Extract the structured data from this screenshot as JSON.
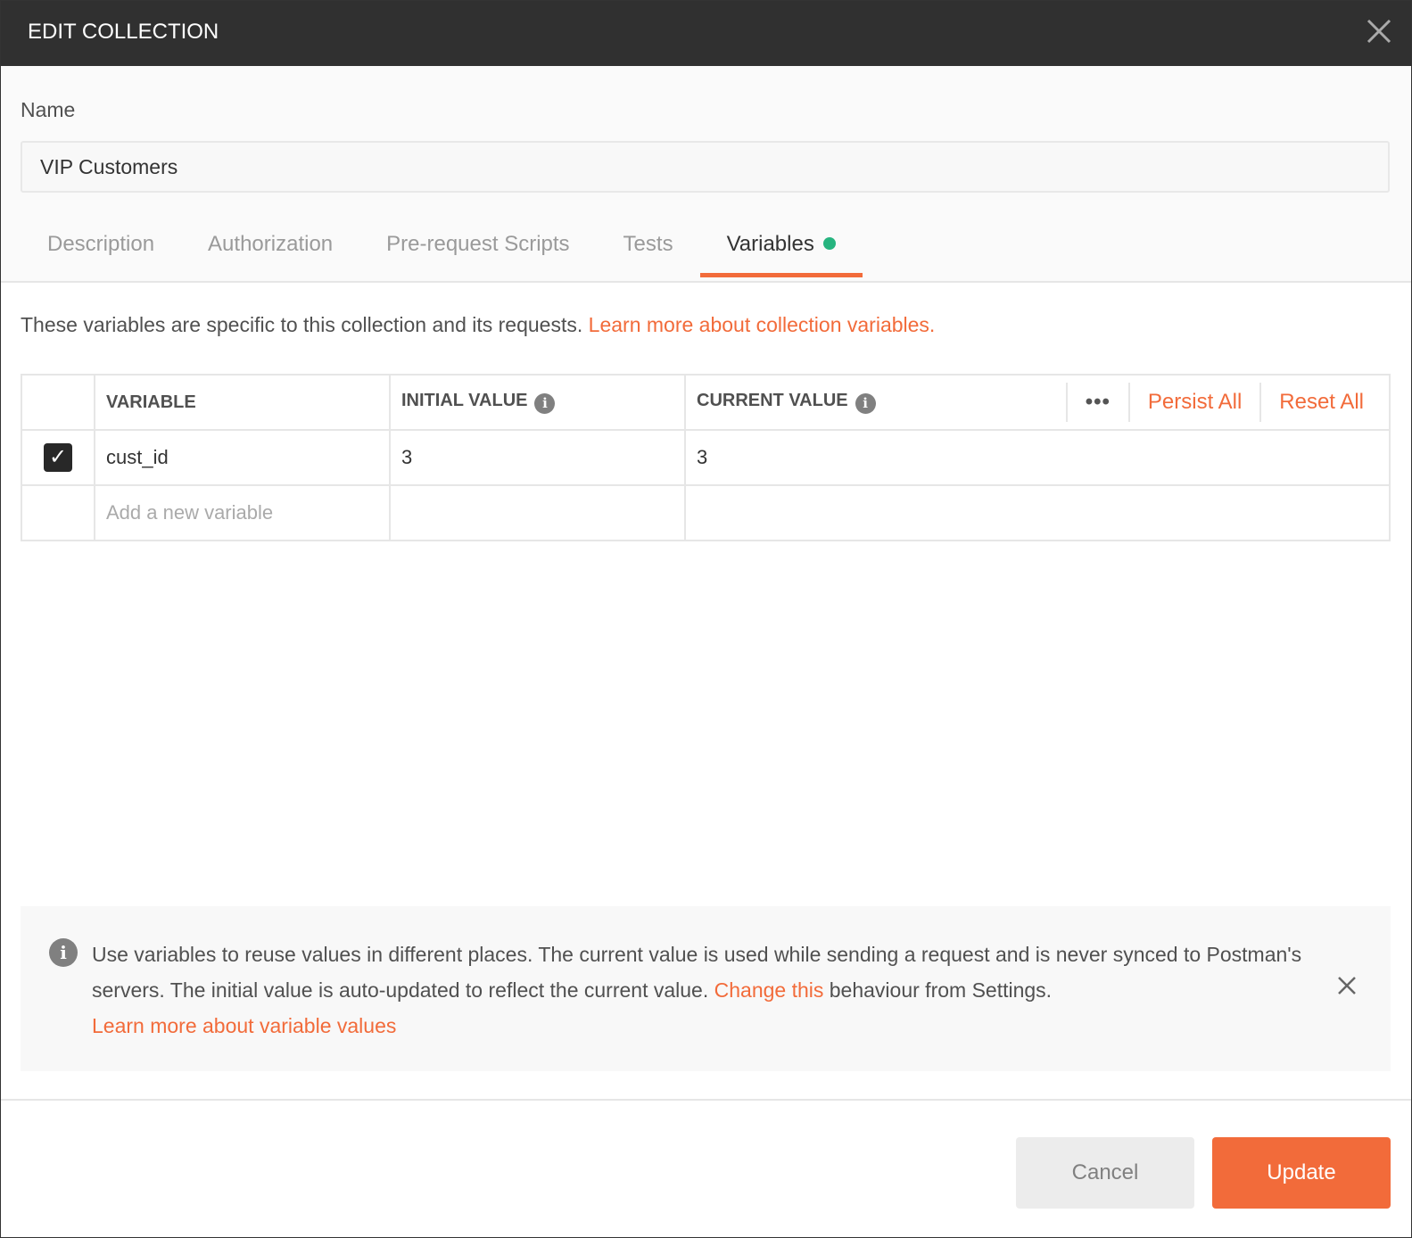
{
  "dialog": {
    "title": "EDIT COLLECTION"
  },
  "name_field": {
    "label": "Name",
    "value": "VIP Customers"
  },
  "tabs": [
    {
      "label": "Description"
    },
    {
      "label": "Authorization"
    },
    {
      "label": "Pre-request Scripts"
    },
    {
      "label": "Tests"
    },
    {
      "label": "Variables",
      "active": true,
      "indicator_color": "#26b47f"
    }
  ],
  "intro": {
    "text": "These variables are specific to this collection and its requests. ",
    "link": "Learn more about collection variables."
  },
  "table": {
    "headers": [
      "VARIABLE",
      "INITIAL VALUE",
      "CURRENT VALUE"
    ],
    "more": "•••",
    "persist_all": "Persist All",
    "reset_all": "Reset All",
    "rows": [
      {
        "enabled": true,
        "variable": "cust_id",
        "initial": "3",
        "current": "3"
      }
    ],
    "new_placeholder": "Add a new variable"
  },
  "banner": {
    "text1": "Use variables to reuse values in different places. The current value is used while sending a request and is never synced to Postman's servers. The initial value is auto-updated to reflect the current value. ",
    "link1": "Change this",
    "text2": " behaviour from Settings.",
    "link2": "Learn more about variable values"
  },
  "footer": {
    "cancel": "Cancel",
    "update": "Update"
  },
  "colors": {
    "accent": "#f26b3a",
    "header": "#303030"
  }
}
